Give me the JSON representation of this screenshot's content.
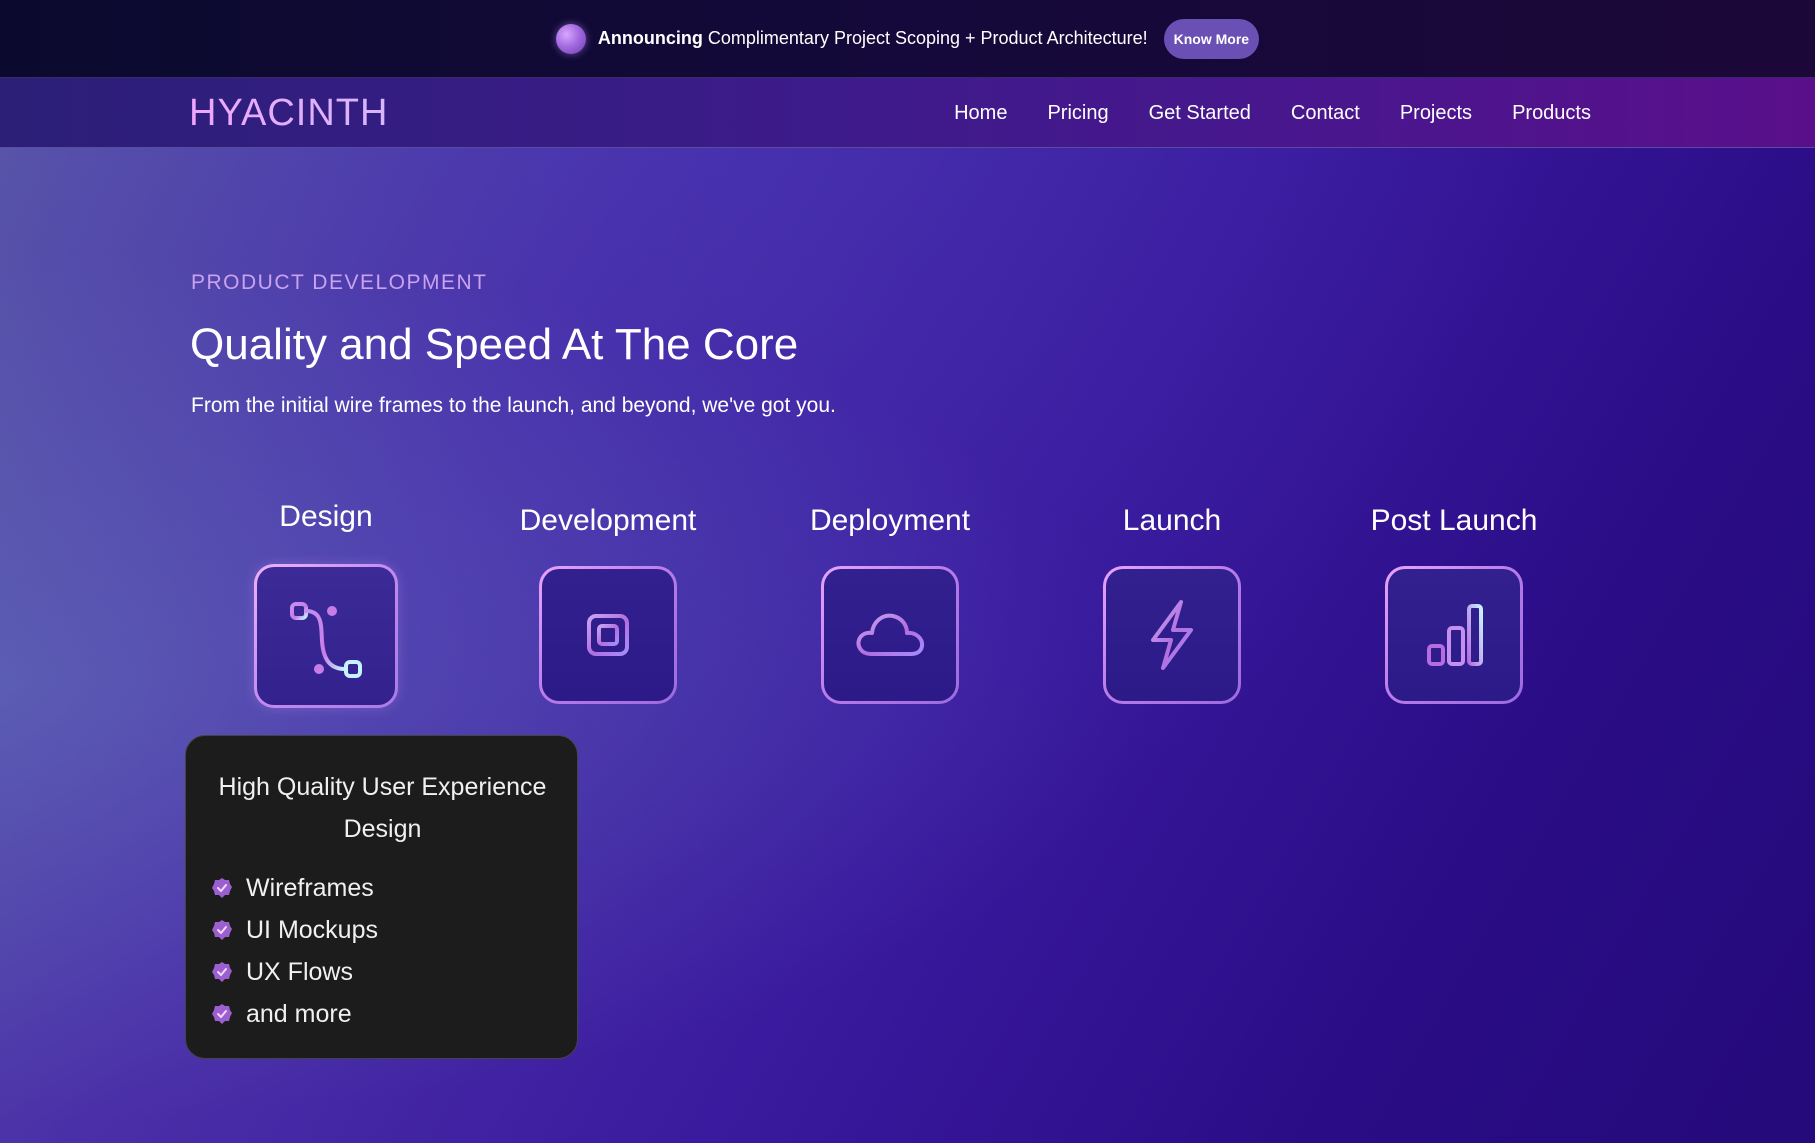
{
  "announcement": {
    "strong": "Announcing",
    "text": "Complimentary Project Scoping + Product Architecture!",
    "button": "Know More"
  },
  "nav": {
    "brand": "HYACINTH",
    "links": [
      "Home",
      "Pricing",
      "Get Started",
      "Contact",
      "Projects",
      "Products"
    ]
  },
  "hero": {
    "eyebrow": "PRODUCT DEVELOPMENT",
    "title": "Quality and Speed At The Core",
    "subtitle": "From the initial wire frames to the launch, and beyond, we've got you."
  },
  "stages": [
    {
      "label": "Design",
      "icon": "vector-path-icon",
      "active": true
    },
    {
      "label": "Development",
      "icon": "cpu-chip-icon",
      "active": false
    },
    {
      "label": "Deployment",
      "icon": "cloud-icon",
      "active": false
    },
    {
      "label": "Launch",
      "icon": "lightning-bolt-icon",
      "active": false
    },
    {
      "label": "Post Launch",
      "icon": "bar-chart-icon",
      "active": false
    }
  ],
  "detail_card": {
    "title": "High Quality User Experience Design",
    "items": [
      "Wireframes",
      "UI Mockups",
      "UX Flows",
      "and more"
    ]
  },
  "colors": {
    "accent_pink": "#e6a4ff",
    "accent_purple": "#6a4fb5",
    "card_bg": "#1c1c1c",
    "icon_cyan": "#bff2ff"
  }
}
